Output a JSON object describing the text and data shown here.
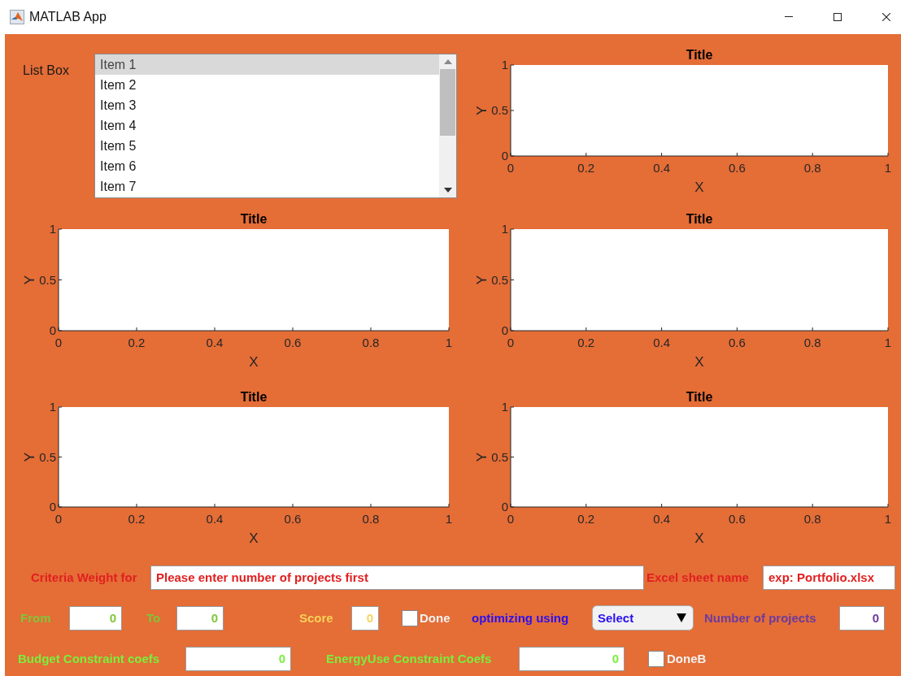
{
  "window": {
    "title": "MATLAB App"
  },
  "list_box": {
    "label": "List Box",
    "items": [
      {
        "label": "Item 1",
        "selected": true
      },
      {
        "label": "Item 2",
        "selected": false
      },
      {
        "label": "Item 3",
        "selected": false
      },
      {
        "label": "Item 4",
        "selected": false
      },
      {
        "label": "Item 5",
        "selected": false
      },
      {
        "label": "Item 6",
        "selected": false
      },
      {
        "label": "Item 7",
        "selected": false
      }
    ]
  },
  "charts": [
    {
      "chart_data": {
        "type": "line",
        "title": "Title",
        "xlabel": "X",
        "ylabel": "Y",
        "xlim": [
          0,
          1
        ],
        "ylim": [
          0,
          1
        ],
        "xticks": [
          0,
          0.2,
          0.4,
          0.6,
          0.8,
          1
        ],
        "yticks": [
          0,
          0.5,
          1
        ]
      }
    },
    {
      "chart_data": {
        "type": "line",
        "title": "Title",
        "xlabel": "X",
        "ylabel": "Y",
        "xlim": [
          0,
          1
        ],
        "ylim": [
          0,
          1
        ],
        "xticks": [
          0,
          0.2,
          0.4,
          0.6,
          0.8,
          1
        ],
        "yticks": [
          0,
          0.5,
          1
        ]
      }
    },
    {
      "chart_data": {
        "type": "line",
        "title": "Title",
        "xlabel": "X",
        "ylabel": "Y",
        "xlim": [
          0,
          1
        ],
        "ylim": [
          0,
          1
        ],
        "xticks": [
          0,
          0.2,
          0.4,
          0.6,
          0.8,
          1
        ],
        "yticks": [
          0,
          0.5,
          1
        ]
      }
    },
    {
      "chart_data": {
        "type": "line",
        "title": "Title",
        "xlabel": "X",
        "ylabel": "Y",
        "xlim": [
          0,
          1
        ],
        "ylim": [
          0,
          1
        ],
        "xticks": [
          0,
          0.2,
          0.4,
          0.6,
          0.8,
          1
        ],
        "yticks": [
          0,
          0.5,
          1
        ]
      }
    },
    {
      "chart_data": {
        "type": "line",
        "title": "Title",
        "xlabel": "X",
        "ylabel": "Y",
        "xlim": [
          0,
          1
        ],
        "ylim": [
          0,
          1
        ],
        "xticks": [
          0,
          0.2,
          0.4,
          0.6,
          0.8,
          1
        ],
        "yticks": [
          0,
          0.5,
          1
        ]
      }
    }
  ],
  "criteria_weight": {
    "label": "Criteria Weight for",
    "value": "Please enter number of projects first"
  },
  "excel_sheet": {
    "label": "Excel sheet name",
    "value": "exp: Portfolio.xlsx"
  },
  "from": {
    "label": "From",
    "value": "0"
  },
  "to": {
    "label": "To",
    "value": "0"
  },
  "score": {
    "label": "Score",
    "value": "0"
  },
  "done": {
    "label": "Done",
    "checked": false
  },
  "optimizing": {
    "label": "optimizing using",
    "value": "Select"
  },
  "number_of_projects": {
    "label": "Number of projects",
    "value": "0"
  },
  "budget": {
    "label": "Budget Constraint coefs",
    "value": "0"
  },
  "energy_use": {
    "label": "EnergyUse Constraint Coefs",
    "value": "0"
  },
  "done_b": {
    "label": "DoneB",
    "checked": false
  }
}
